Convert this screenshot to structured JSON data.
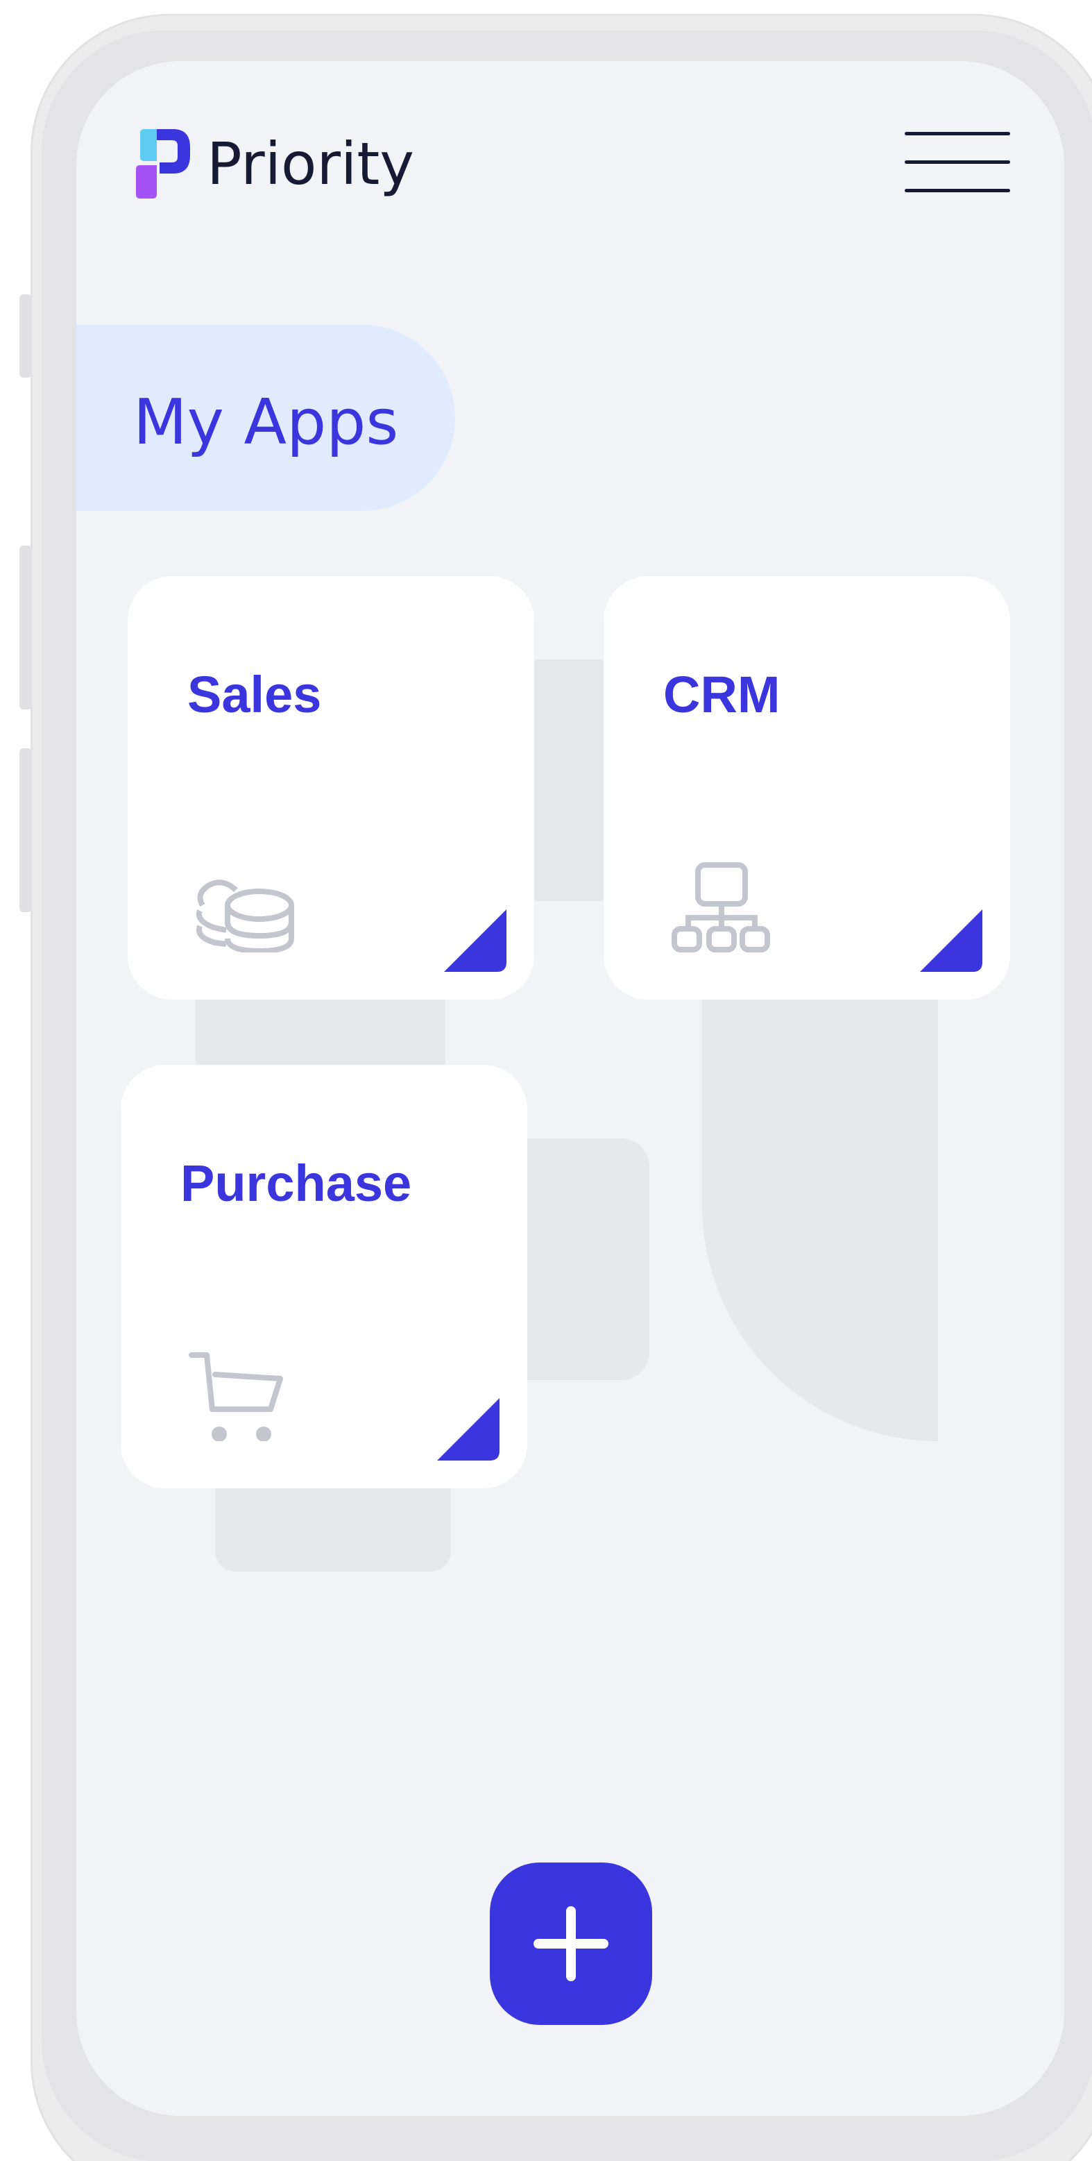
{
  "app": {
    "brand_name": "Priority",
    "brand_colors": {
      "primary": "#3b35de",
      "logo_cyan": "#5ecbf2",
      "logo_purple": "#a451f5",
      "logo_blue": "#3b35de",
      "text_dark": "#161a33"
    }
  },
  "header": {
    "logo_icon": "priority-logo-icon",
    "menu_icon": "hamburger-menu-icon"
  },
  "section": {
    "title": "My Apps"
  },
  "apps": [
    {
      "label": "Sales",
      "icon": "coins-stack-icon"
    },
    {
      "label": "CRM",
      "icon": "org-chart-icon"
    },
    {
      "label": "Purchase",
      "icon": "shopping-cart-icon"
    }
  ],
  "fab": {
    "icon": "plus-icon"
  }
}
